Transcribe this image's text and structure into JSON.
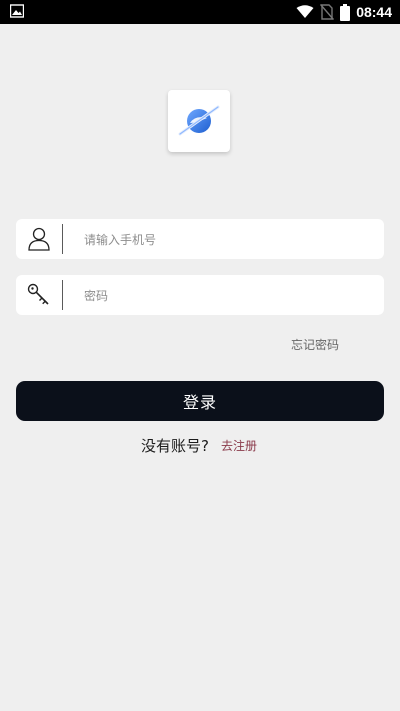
{
  "status_bar": {
    "time": "08:44",
    "icons": [
      "image-icon",
      "wifi-icon",
      "no-sim-icon",
      "battery-icon"
    ]
  },
  "logo": {
    "icon": "planet-logo-icon",
    "colors": [
      "#3b7fe0",
      "#1e5fd0"
    ]
  },
  "form": {
    "phone": {
      "placeholder": "请输入手机号",
      "value": "",
      "icon": "user-icon"
    },
    "password": {
      "placeholder": "密码",
      "value": "",
      "icon": "key-icon"
    },
    "forgot_label": "忘记密码",
    "login_label": "登录",
    "no_account_label": "没有账号?",
    "register_label": "去注册"
  },
  "colors": {
    "background": "#efefef",
    "button": "#0b101a",
    "register_link": "#8a3a4a"
  }
}
